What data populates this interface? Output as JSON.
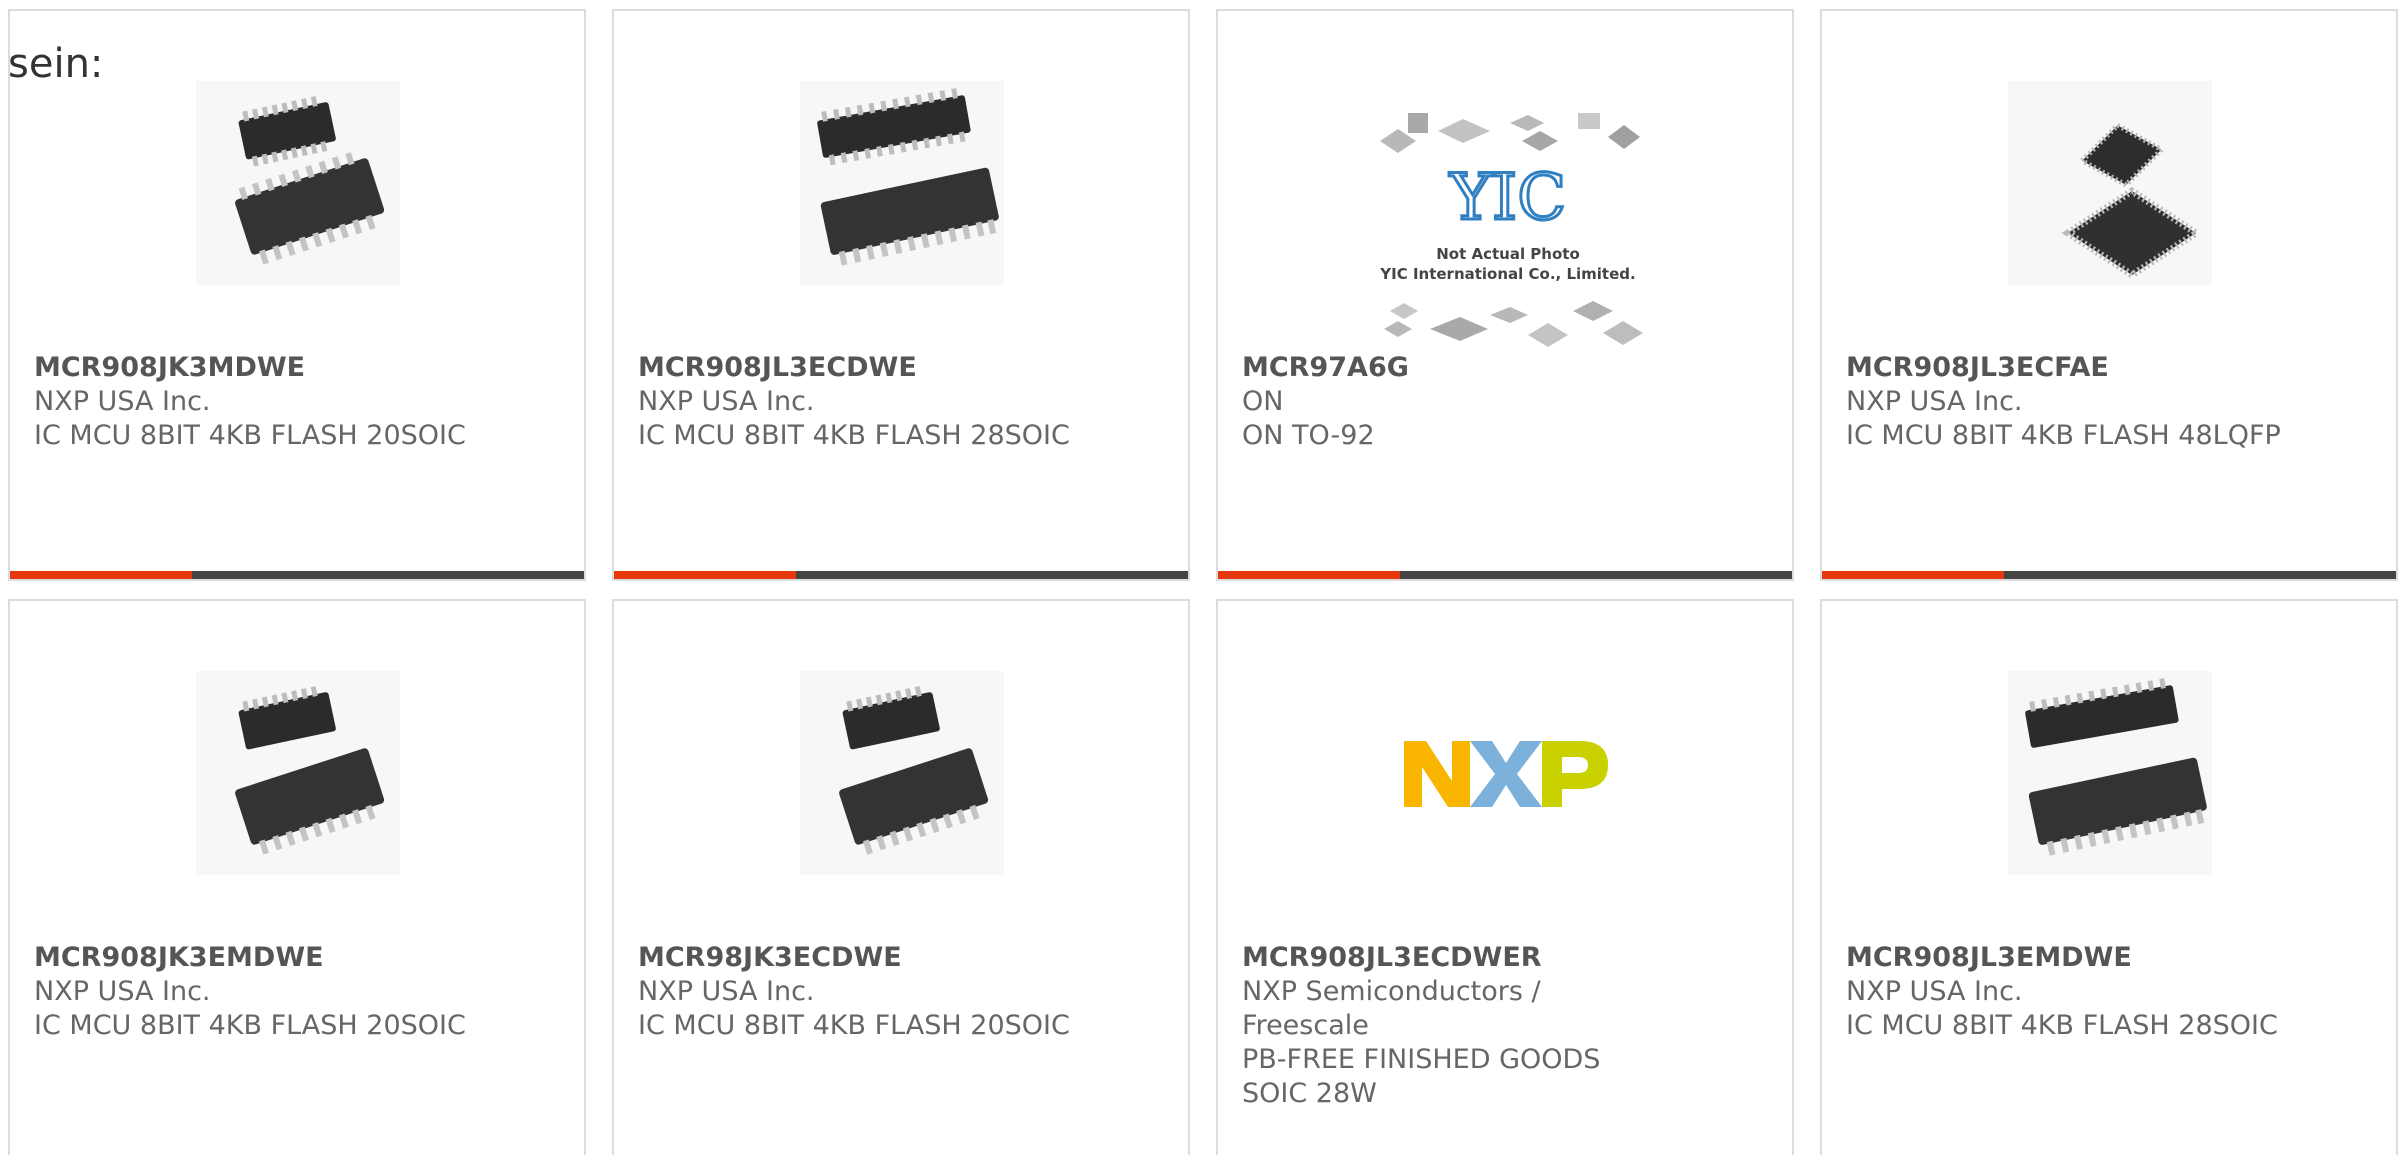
{
  "lead_text": "sein:",
  "accent_color": "#e8380d",
  "bar_color": "#444444",
  "products": [
    {
      "part": "MCR908JK3MDWE",
      "maker": "NXP USA Inc.",
      "desc": "IC MCU 8BIT 4KB FLASH 20SOIC",
      "image": "soic-chips-icon"
    },
    {
      "part": "MCR908JL3ECDWE",
      "maker": "NXP USA Inc.",
      "desc": "IC MCU 8BIT 4KB FLASH 28SOIC",
      "image": "soic-chips-icon"
    },
    {
      "part": "MCR97A6G",
      "maker": "ON",
      "desc": "ON TO-92",
      "image": "yic-placeholder-icon",
      "placeholder_text": [
        "YIC",
        "Not Actual Photo",
        "YIC International Co., Limited."
      ]
    },
    {
      "part": "MCR908JL3ECFAE",
      "maker": "NXP USA Inc.",
      "desc": "IC MCU 8BIT 4KB FLASH 48LQFP",
      "image": "lqfp-chips-icon"
    },
    {
      "part": "MCR908JK3EMDWE",
      "maker": "NXP USA Inc.",
      "desc": "IC MCU 8BIT 4KB FLASH 20SOIC",
      "image": "soic-chips-icon"
    },
    {
      "part": "MCR98JK3ECDWE",
      "maker": "NXP USA Inc.",
      "desc": "IC MCU 8BIT 4KB FLASH 20SOIC",
      "image": "soic-chips-icon"
    },
    {
      "part": "MCR908JL3ECDWER",
      "maker": "NXP Semiconductors / Freescale",
      "desc": "PB-FREE FINISHED GOODS SOIC 28W",
      "image": "nxp-logo-icon"
    },
    {
      "part": "MCR908JL3EMDWE",
      "maker": "NXP USA Inc.",
      "desc": "IC MCU 8BIT 4KB FLASH 28SOIC",
      "image": "soic-chips-icon"
    }
  ]
}
